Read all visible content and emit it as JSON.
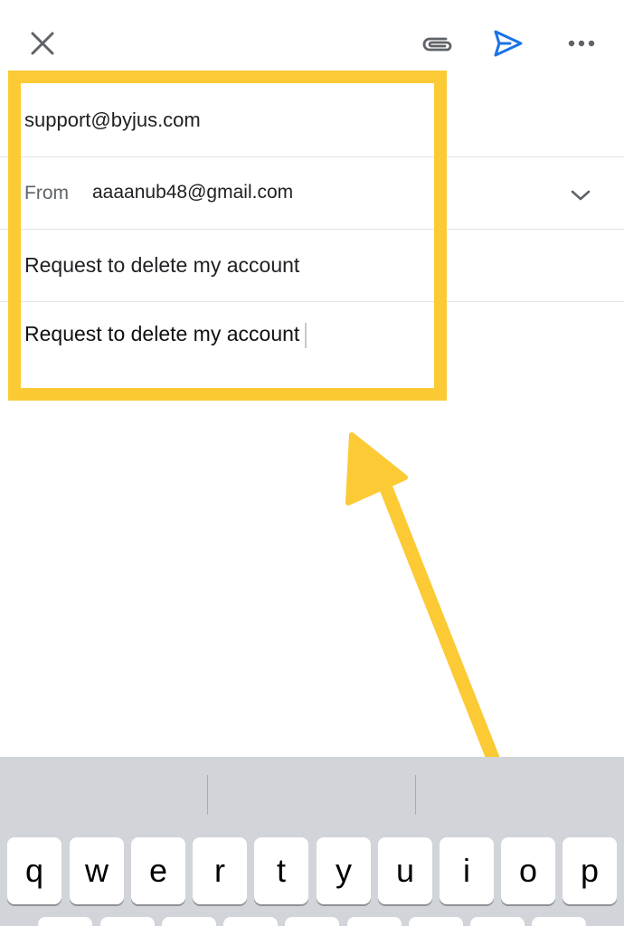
{
  "compose": {
    "to_value": "support@byjus.com",
    "from_label": "From",
    "from_value": "aaaanub48@gmail.com",
    "subject_value": "Request to delete my account",
    "body_value": "Request to delete my account"
  },
  "toolbar": {
    "icons": [
      "close-icon",
      "attachment-icon",
      "send-icon",
      "more-icon"
    ]
  },
  "colors": {
    "highlight": "#fbca34",
    "send_icon": "#1a73e8",
    "keyboard_bg": "#d1d4d9"
  },
  "keyboard": {
    "row1": [
      "q",
      "w",
      "e",
      "r",
      "t",
      "y",
      "u",
      "i",
      "o",
      "p"
    ]
  }
}
